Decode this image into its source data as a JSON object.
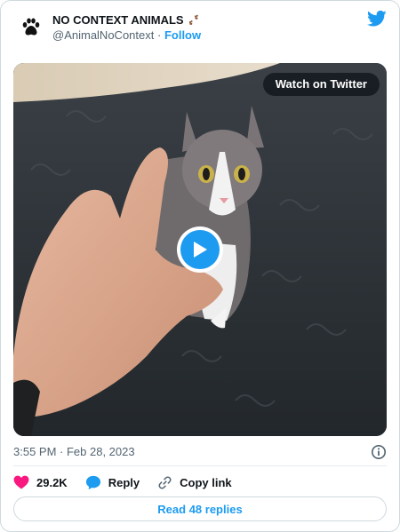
{
  "account": {
    "display_name": "NO CONTEXT ANIMALS",
    "handle": "@AnimalNoContext",
    "separator": "·",
    "follow_label": "Follow"
  },
  "media": {
    "watch_label": "Watch on Twitter"
  },
  "tweet": {
    "timestamp": "3:55 PM · Feb 28, 2023"
  },
  "actions": {
    "like_count": "29.2K",
    "reply_label": "Reply",
    "copy_label": "Copy link"
  },
  "footer": {
    "read_replies_label": "Read 48 replies"
  },
  "colors": {
    "accent": "#1d9bf0",
    "like": "#f91880",
    "muted": "#536471"
  },
  "icons": {
    "avatar": "paw-print-icon",
    "brand": "twitter-bird-icon",
    "like": "heart-icon",
    "reply": "speech-bubble-icon",
    "copy": "link-icon",
    "info": "info-icon",
    "play": "play-icon"
  }
}
